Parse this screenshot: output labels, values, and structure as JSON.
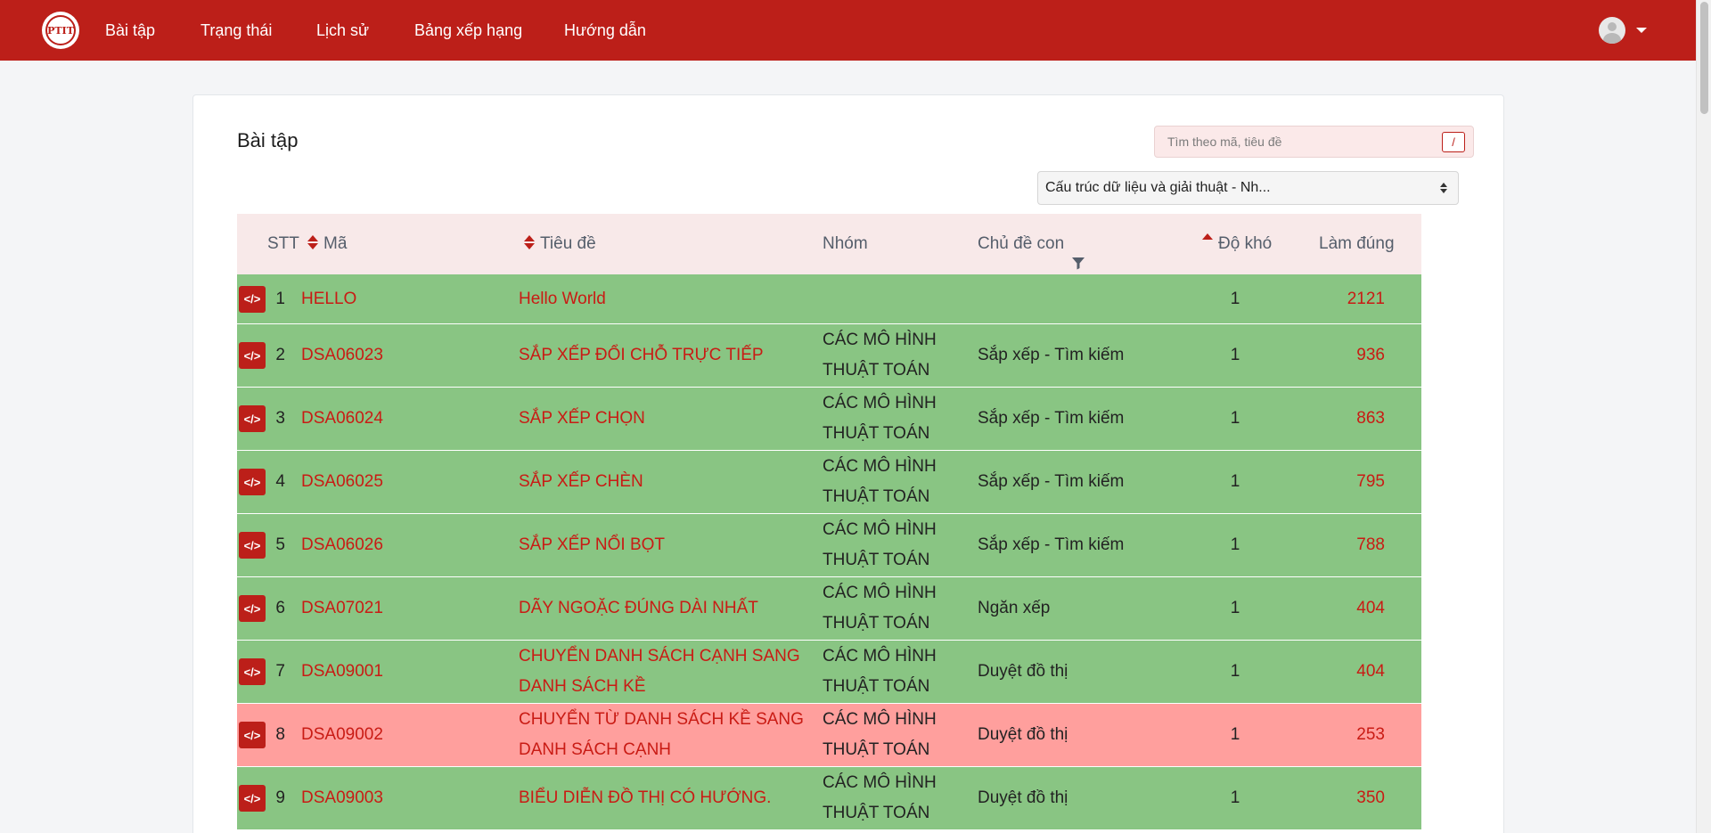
{
  "nav": {
    "logo_text": "PTIT",
    "items": [
      "Bài tập",
      "Trạng thái",
      "Lịch sử",
      "Bảng xếp hạng",
      "Hướng dẫn"
    ]
  },
  "page": {
    "title": "Bài tập",
    "search_placeholder": "Tìm theo mã, tiêu đề",
    "search_shortcut": "/",
    "course_select": "Cấu trúc dữ liệu và giải thuật - Nh..."
  },
  "table": {
    "headers": {
      "stt": "STT",
      "code": "Mã",
      "title": "Tiêu đề",
      "group": "Nhóm",
      "topic": "Chủ đề con",
      "difficulty": "Độ khó",
      "solved": "Làm đúng"
    },
    "code_icon": "</>",
    "rows": [
      {
        "stt": "1",
        "code": "HELLO",
        "title": "Hello World",
        "group": "",
        "topic": "",
        "difficulty": "1",
        "solved": "2121",
        "status": "green"
      },
      {
        "stt": "2",
        "code": "DSA06023",
        "title": "SẮP XẾP ĐỔI CHỖ TRỰC TIẾP",
        "group": "CÁC MÔ HÌNH THUẬT TOÁN",
        "topic": "Sắp xếp - Tìm kiếm",
        "difficulty": "1",
        "solved": "936",
        "status": "green"
      },
      {
        "stt": "3",
        "code": "DSA06024",
        "title": "SẮP XẾP CHỌN",
        "group": "CÁC MÔ HÌNH THUẬT TOÁN",
        "topic": "Sắp xếp - Tìm kiếm",
        "difficulty": "1",
        "solved": "863",
        "status": "green"
      },
      {
        "stt": "4",
        "code": "DSA06025",
        "title": "SẮP XẾP CHÈN",
        "group": "CÁC MÔ HÌNH THUẬT TOÁN",
        "topic": "Sắp xếp - Tìm kiếm",
        "difficulty": "1",
        "solved": "795",
        "status": "green"
      },
      {
        "stt": "5",
        "code": "DSA06026",
        "title": "SẮP XẾP NỔI BỌT",
        "group": "CÁC MÔ HÌNH THUẬT TOÁN",
        "topic": "Sắp xếp - Tìm kiếm",
        "difficulty": "1",
        "solved": "788",
        "status": "green"
      },
      {
        "stt": "6",
        "code": "DSA07021",
        "title": "DÃY NGOẶC ĐÚNG DÀI NHẤT",
        "group": "CÁC MÔ HÌNH THUẬT TOÁN",
        "topic": "Ngăn xếp",
        "difficulty": "1",
        "solved": "404",
        "status": "green"
      },
      {
        "stt": "7",
        "code": "DSA09001",
        "title": "CHUYỂN DANH SÁCH CẠNH SANG DANH SÁCH KỀ",
        "group": "CÁC MÔ HÌNH THUẬT TOÁN",
        "topic": "Duyệt đồ thị",
        "difficulty": "1",
        "solved": "404",
        "status": "green"
      },
      {
        "stt": "8",
        "code": "DSA09002",
        "title": "CHUYỂN TỪ DANH SÁCH KỀ SANG DANH SÁCH CẠNH",
        "group": "CÁC MÔ HÌNH THUẬT TOÁN",
        "topic": "Duyệt đồ thị",
        "difficulty": "1",
        "solved": "253",
        "status": "red"
      },
      {
        "stt": "9",
        "code": "DSA09003",
        "title": "BIỂU DIỄN ĐỒ THỊ CÓ HƯỚNG.",
        "group": "CÁC MÔ HÌNH THUẬT TOÁN",
        "topic": "Duyệt đồ thị",
        "difficulty": "1",
        "solved": "350",
        "status": "green"
      }
    ]
  },
  "colors": {
    "brand": "#bc1f19",
    "solved_row": "#89c583",
    "unsolved_row": "#ff9f9d",
    "link": "#c91b14"
  },
  "icons": [
    "logo",
    "user-avatar-icon",
    "chevron-down-icon",
    "sort-icon",
    "sort-asc-icon",
    "filter-icon",
    "code-icon"
  ]
}
